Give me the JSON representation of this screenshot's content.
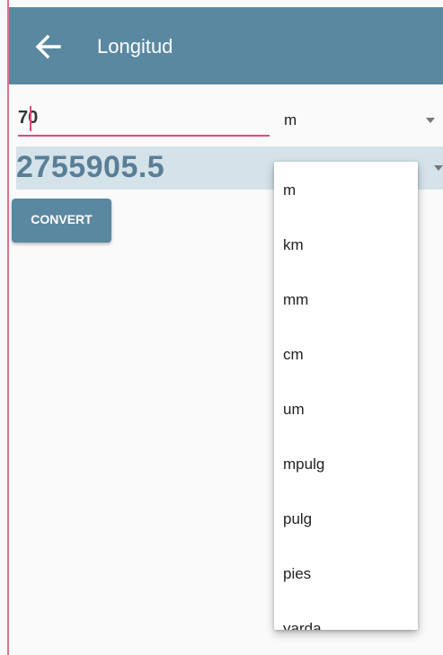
{
  "appbar": {
    "title": "Longitud"
  },
  "input": {
    "value": "70"
  },
  "from_unit": {
    "selected": "m"
  },
  "result": {
    "value": "2755905.5"
  },
  "convert_label": "CONVERT",
  "dropdown": {
    "items": [
      "m",
      "km",
      "mm",
      "cm",
      "um",
      "mpulg",
      "pulg",
      "pies",
      "yarda"
    ]
  },
  "colors": {
    "primary": "#5b88a1",
    "accent": "#e04a78",
    "result_bg": "#d4e2ea",
    "result_text": "#5a7e96"
  }
}
